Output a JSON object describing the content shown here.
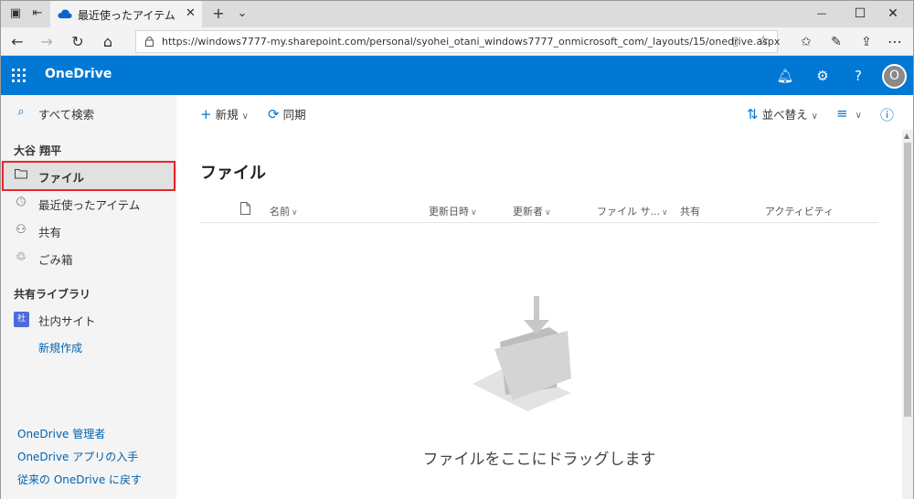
{
  "browser": {
    "tab_title": "最近使ったアイテム - OneI",
    "tab_close": "✕",
    "new_tab": "+",
    "tab_menu": "⌄",
    "url": "https://windows7777-my.sharepoint.com/personal/syohei_otani_windows7777_onmicrosoft_com/_layouts/15/onedrive.aspx",
    "minimize": "—",
    "maximize": "☐",
    "close": "✕"
  },
  "suite": {
    "brand": "OneDrive",
    "avatar_initial": "O"
  },
  "leftnav": {
    "search_label": "すべて検索",
    "user_name": "大谷 翔平",
    "items": [
      {
        "label": "ファイル",
        "icon": "folder-icon"
      },
      {
        "label": "最近使ったアイテム",
        "icon": "clock-icon"
      },
      {
        "label": "共有",
        "icon": "people-icon"
      },
      {
        "label": "ごみ箱",
        "icon": "recycle-bin-icon"
      }
    ],
    "shared_libraries_heading": "共有ライブラリ",
    "site_badge": "社",
    "site_name": "社内サイト",
    "create_new": "新規作成",
    "footer_links": [
      "OneDrive 管理者",
      "OneDrive アプリの入手",
      "従来の OneDrive に戻す"
    ]
  },
  "commandbar": {
    "new_label": "新規",
    "sync_label": "同期",
    "sort_label": "並べ替え"
  },
  "main": {
    "title": "ファイル",
    "columns": {
      "name": "名前",
      "modified": "更新日時",
      "modified_by": "更新者",
      "file_size": "ファイル サ...",
      "sharing": "共有",
      "activity": "アクティビティ"
    },
    "empty_message": "ファイルをここにドラッグします"
  },
  "colors": {
    "accent": "#0078d4",
    "highlight_box": "#e8262a",
    "nav_bg": "#f4f4f4"
  }
}
